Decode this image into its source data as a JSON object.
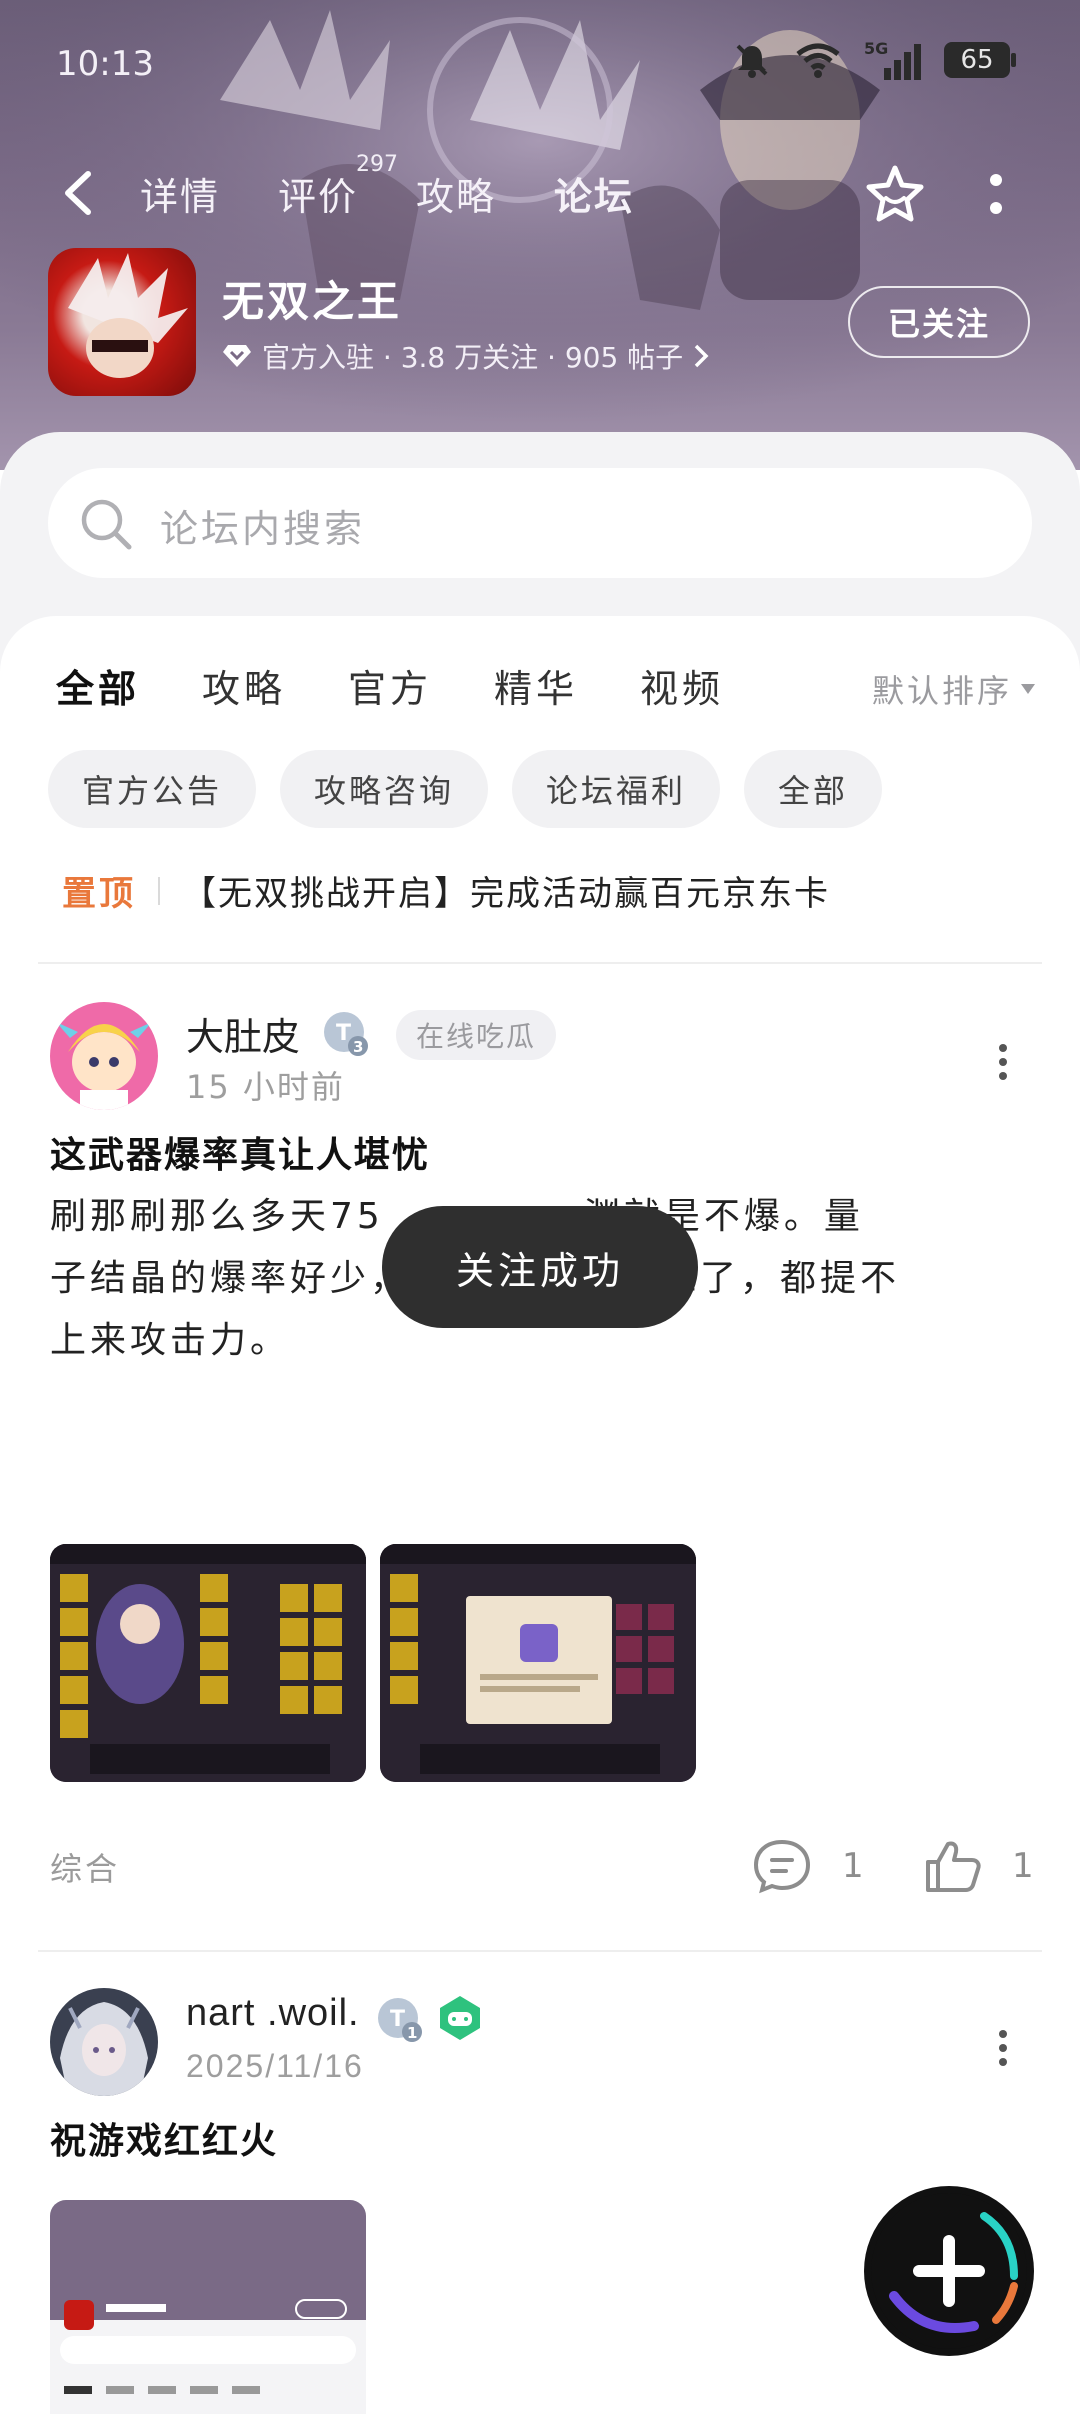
{
  "status_bar": {
    "time": "10:13",
    "network": "5G",
    "battery": "65"
  },
  "nav": {
    "tabs": [
      {
        "label": "详情"
      },
      {
        "label": "评价",
        "badge": "297"
      },
      {
        "label": "攻略"
      },
      {
        "label": "论坛",
        "active": true
      }
    ]
  },
  "game": {
    "title": "无双之王",
    "meta": "官方入驻 · 3.8 万关注 · 905 帖子",
    "follow_label": "已关注"
  },
  "search": {
    "placeholder": "论坛内搜索"
  },
  "filter_tabs": [
    "全部",
    "攻略",
    "官方",
    "精华",
    "视频"
  ],
  "sort_label": "默认排序",
  "chips": [
    "官方公告",
    "攻略咨询",
    "论坛福利",
    "全部"
  ],
  "pinned": {
    "tag": "置顶",
    "text": "【无双挑战开启】完成活动赢百元京东卡"
  },
  "posts": [
    {
      "author": "大肚皮",
      "level": "3",
      "tag": "在线吃瓜",
      "time": "15 小时前",
      "title": "这武器爆率真让人堪忧",
      "body_line1": "刷那刷那么多天75",
      "body_line1_tail": "渊就是不爆。量",
      "body_line2": "子结晶的爆率好少，",
      "body_line2_tail": "太难了，都提不",
      "body_line3": "上来攻击力。",
      "category": "综合",
      "comments": "1",
      "likes": "1"
    },
    {
      "author": "nart .woil.",
      "level": "1",
      "time": "2025/11/16",
      "title": "祝游戏红红火"
    }
  ],
  "toast": "关注成功",
  "colors": {
    "accent": "#29d2c5",
    "pinned": "#e9783b",
    "header_bg": "#7a6a86"
  },
  "icons": [
    "back-icon",
    "star-icon",
    "more-icon",
    "search-icon",
    "comment-icon",
    "like-icon",
    "plus-icon",
    "diamond-icon",
    "chevron-right-icon"
  ]
}
